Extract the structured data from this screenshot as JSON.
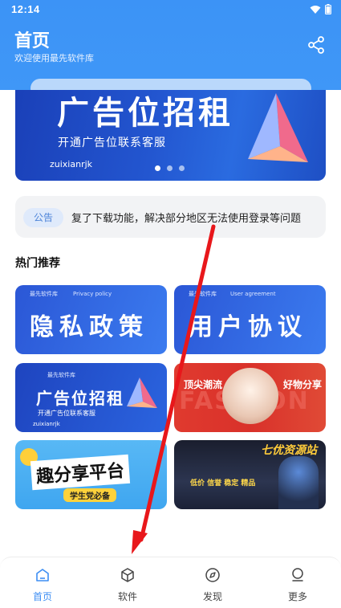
{
  "status": {
    "time": "12:14"
  },
  "header": {
    "title": "首页",
    "subtitle": "欢迎使用最先软件库"
  },
  "banner": {
    "headline": "广告位招租",
    "subline": "开通广告位联系客服",
    "brand": "zuixianrjk"
  },
  "notice": {
    "tag": "公告",
    "text": "复了下载功能，解决部分地区无法使用登录等问题"
  },
  "section": {
    "title": "热门推荐"
  },
  "cards": [
    {
      "headline": "隐私政策",
      "caption": "Privacy policy",
      "badge": "最先软件库"
    },
    {
      "headline": "用户协议",
      "caption": "User agreement",
      "badge": "最先软件库"
    },
    {
      "headline": "广告位招租",
      "caption": "开通广告位联系客服",
      "badge": "最先软件库",
      "brand": "zuixianrjk"
    },
    {
      "left": "顶尖潮流",
      "right": "好物分享",
      "bg": "FASHION"
    },
    {
      "headline": "趣分享平台",
      "ribbon": "学生党必备"
    },
    {
      "headline": "七优资源站",
      "caption": "低价 信誉 稳定 精品"
    }
  ],
  "tabs": [
    {
      "label": "首页",
      "icon": "home-icon"
    },
    {
      "label": "软件",
      "icon": "cube-icon"
    },
    {
      "label": "发现",
      "icon": "compass-icon"
    },
    {
      "label": "更多",
      "icon": "person-icon"
    }
  ],
  "colors": {
    "accent": "#3d8ef3",
    "banner": "#2356d0",
    "red": "#d9312a"
  }
}
